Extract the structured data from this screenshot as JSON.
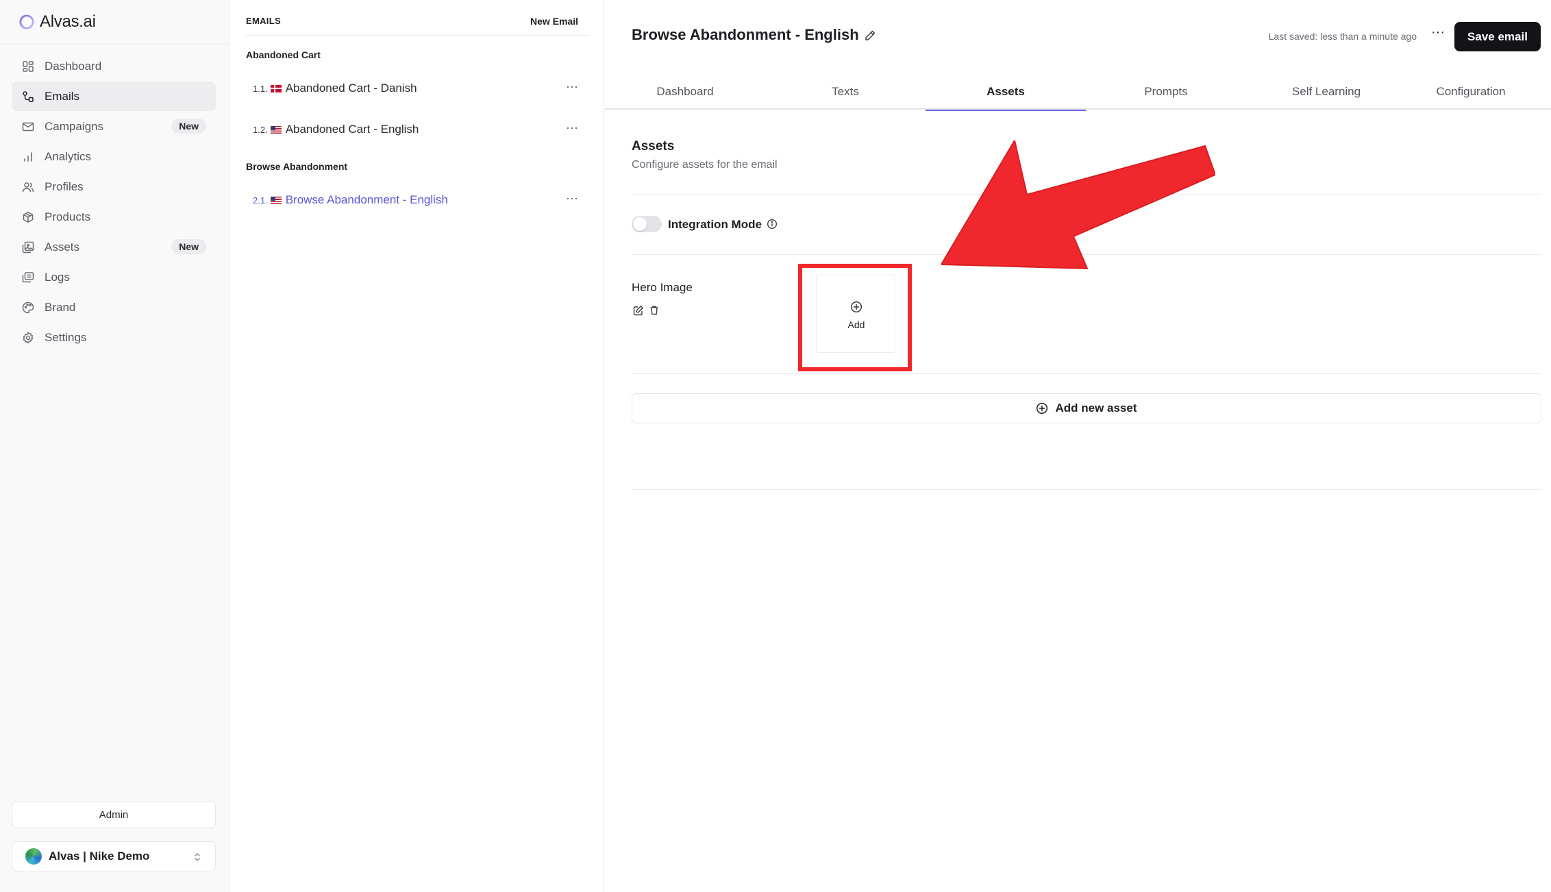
{
  "app": {
    "name": "Alvas.ai"
  },
  "sidebar": {
    "items": [
      {
        "label": "Dashboard",
        "icon": "dashboard-icon",
        "active": false
      },
      {
        "label": "Emails",
        "icon": "emails-icon",
        "active": true
      },
      {
        "label": "Campaigns",
        "icon": "mail-icon",
        "badge": "New",
        "active": false
      },
      {
        "label": "Analytics",
        "icon": "bar-chart-icon",
        "active": false
      },
      {
        "label": "Profiles",
        "icon": "users-icon",
        "active": false
      },
      {
        "label": "Products",
        "icon": "package-icon",
        "active": false
      },
      {
        "label": "Assets",
        "icon": "images-icon",
        "badge": "New",
        "active": false
      },
      {
        "label": "Logs",
        "icon": "logs-icon",
        "active": false
      },
      {
        "label": "Brand",
        "icon": "palette-icon",
        "active": false
      },
      {
        "label": "Settings",
        "icon": "gear-icon",
        "active": false
      }
    ],
    "admin_label": "Admin",
    "org_name": "Alvas | Nike Demo"
  },
  "email_list": {
    "title": "EMAILS",
    "new_email_label": "New Email",
    "groups": [
      {
        "title": "Abandoned Cart",
        "items": [
          {
            "num": "1.1.",
            "flag": "dk",
            "label": "Abandoned Cart - Danish",
            "active": false
          },
          {
            "num": "1.2.",
            "flag": "us",
            "label": "Abandoned Cart - English",
            "active": false
          }
        ]
      },
      {
        "title": "Browse Abandonment",
        "items": [
          {
            "num": "2.1.",
            "flag": "us",
            "label": "Browse Abandonment - English",
            "active": true
          }
        ]
      }
    ]
  },
  "main": {
    "title": "Browse Abandonment - English",
    "last_saved": "Last saved: less than a minute ago",
    "save_label": "Save email",
    "tabs": [
      {
        "label": "Dashboard",
        "active": false
      },
      {
        "label": "Texts",
        "active": false
      },
      {
        "label": "Assets",
        "active": true
      },
      {
        "label": "Prompts",
        "active": false
      },
      {
        "label": "Self Learning",
        "active": false
      },
      {
        "label": "Configuration",
        "active": false
      }
    ],
    "section_title": "Assets",
    "section_subtitle": "Configure assets for the email",
    "integration_mode_label": "Integration Mode",
    "integration_mode_on": false,
    "asset": {
      "label": "Hero Image",
      "add_label": "Add"
    },
    "add_new_asset_label": "Add new asset",
    "annotation_color": "#f0282d",
    "accent_color": "#6b63db"
  }
}
